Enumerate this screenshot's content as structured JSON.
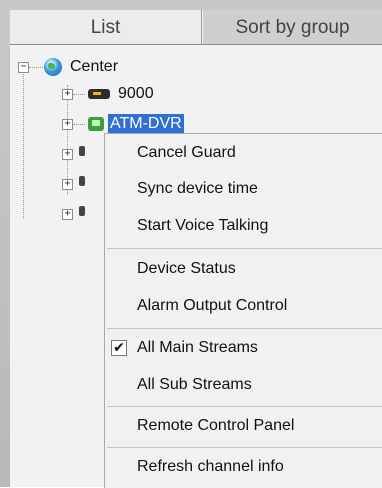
{
  "tabs": {
    "list": "List",
    "sort_by_group": "Sort by group"
  },
  "tree": {
    "root": "Center",
    "device1": "9000",
    "device2": "ATM-DVR"
  },
  "icons": {
    "root": "globe-icon",
    "device1": "dvr-icon",
    "device2": "atm-device-icon"
  },
  "context_menu": {
    "items": [
      "Cancel Guard",
      "Sync device time",
      "Start Voice Talking",
      "Device Status",
      "Alarm Output Control",
      "All Main Streams",
      "All Sub Streams",
      "Remote Control Panel",
      "Refresh channel info"
    ],
    "all_main_streams_checked": true,
    "check_glyph": "✔"
  },
  "colors": {
    "selection": "#2f6fd6",
    "menu_bg": "#f1f1f1"
  }
}
